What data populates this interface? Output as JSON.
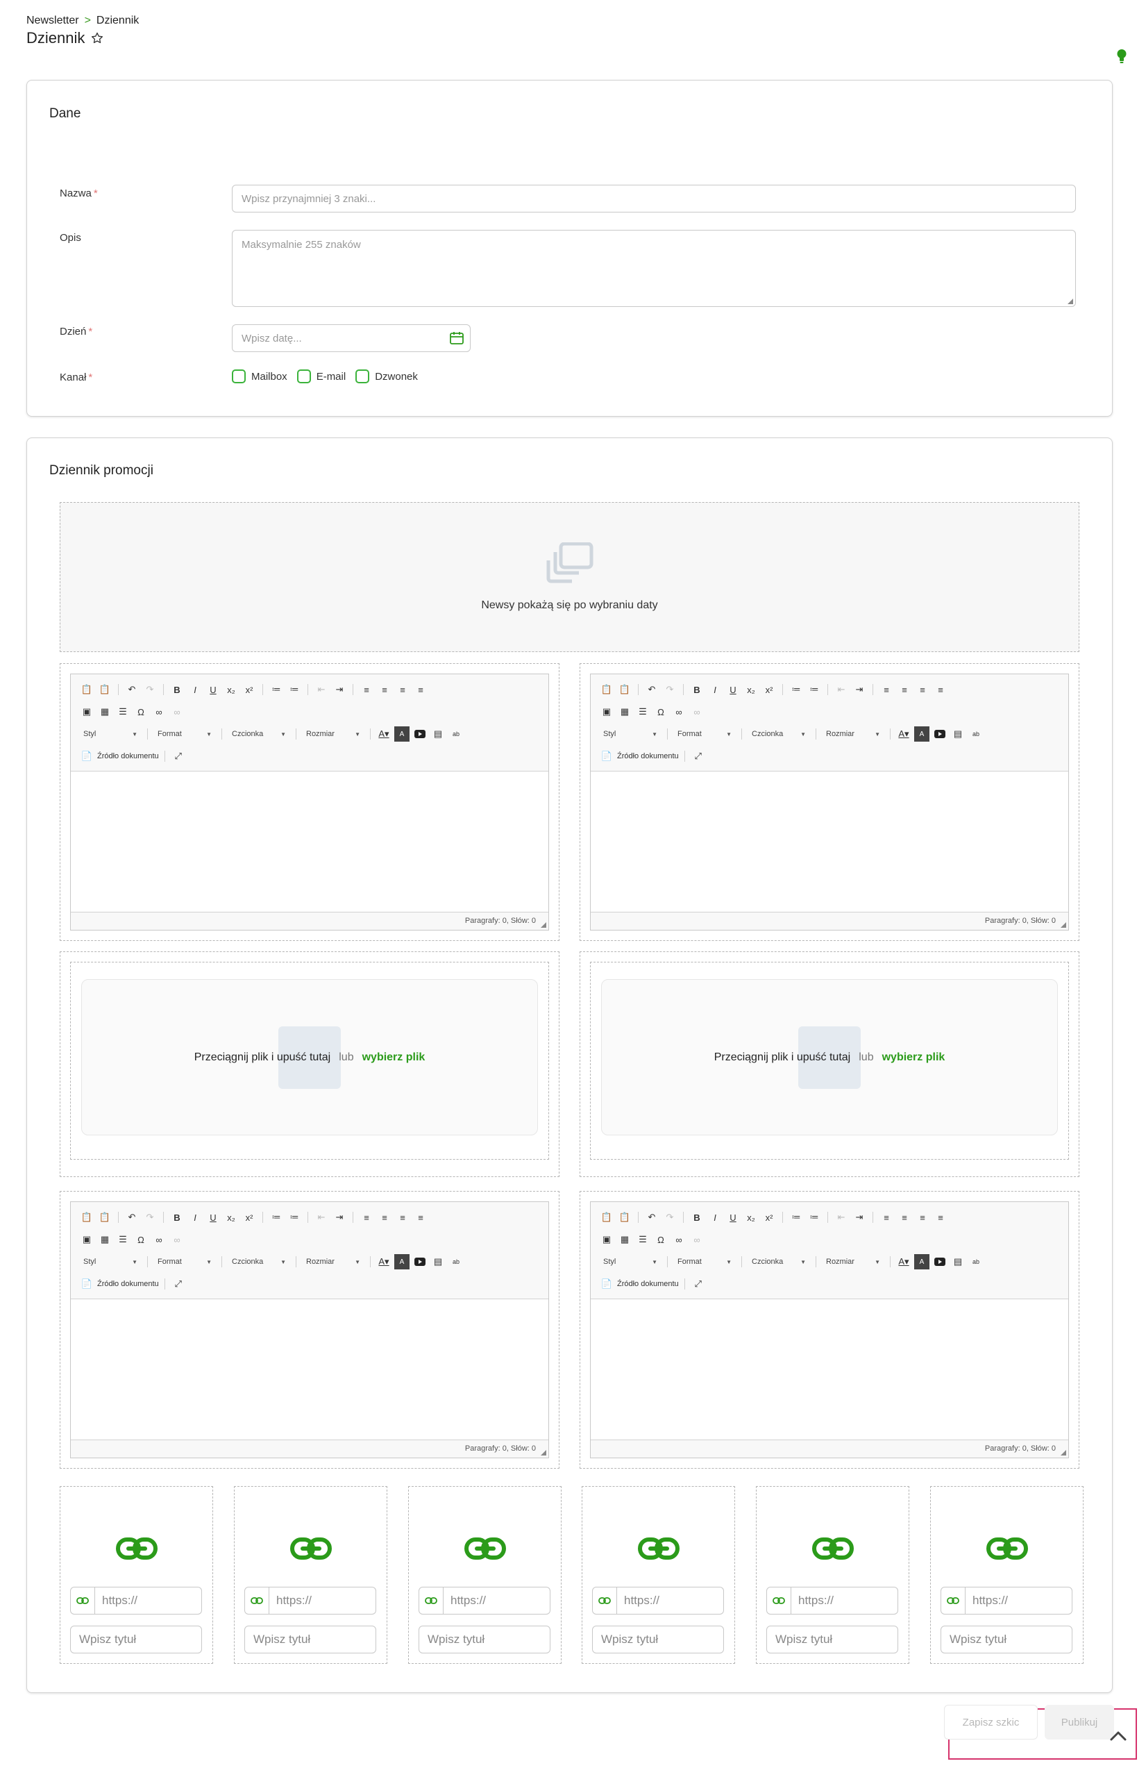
{
  "breadcrumb": {
    "parent": "Newsletter",
    "separator": ">",
    "current": "Dziennik"
  },
  "page": {
    "title": "Dziennik"
  },
  "dane": {
    "title": "Dane",
    "name_label": "Nazwa",
    "name_placeholder": "Wpisz przynajmniej 3 znaki...",
    "desc_label": "Opis",
    "desc_placeholder": "Maksymalnie 255 znaków",
    "day_label": "Dzień",
    "day_placeholder": "Wpisz datę...",
    "channel_label": "Kanał",
    "required_mark": "*",
    "channels": [
      "Mailbox",
      "E-mail",
      "Dzwonek"
    ]
  },
  "promo": {
    "title": "Dziennik promocji",
    "news_empty": "Newsy pokażą się po wybraniu daty",
    "editor": {
      "style": "Styl",
      "format": "Format",
      "font": "Czcionka",
      "size": "Rozmiar",
      "source": "Źródło dokumentu",
      "status": "Paragrafy: 0, Słów: 0"
    },
    "dropzone": {
      "text": "Przeciągnij plik i upuść tutaj",
      "or": "lub",
      "choose": "wybierz plik"
    },
    "link": {
      "url_placeholder": "https://",
      "title_placeholder": "Wpisz tytuł"
    }
  },
  "footer": {
    "draft": "Zapisz szkic",
    "publish": "Publikuj"
  },
  "colors": {
    "accent": "#2b9b1a",
    "highlight": "#d6336c"
  }
}
